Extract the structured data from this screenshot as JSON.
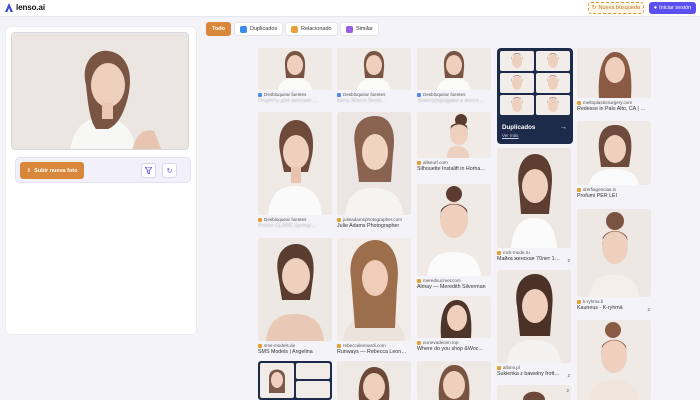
{
  "app": {
    "name": "lenso.ai",
    "new_search": "Nueva búsqueda",
    "login": "Iniciar sesión"
  },
  "left": {
    "upload_label": "Subir nueva foto"
  },
  "tabs": [
    {
      "label": "Todo"
    },
    {
      "label": "Duplicados"
    },
    {
      "label": "Relacionado"
    },
    {
      "label": "Similar"
    }
  ],
  "duplicates": {
    "title": "Duplicados",
    "link": "Ver más"
  },
  "results": {
    "c1r1": {
      "source": "Desbloquear fuentes",
      "caption": "Рецепты для женских ..."
    },
    "c2r1": {
      "source": "Desbloquear fuentes",
      "caption": "Бела Женск Sessi..."
    },
    "c3r1": {
      "source": "Desbloquear fuentes",
      "caption": "Электропродажи и женск..."
    },
    "c5r1": {
      "source": "meltoplasticsurgery.com",
      "caption": "Redesse in Palo Alto, CA | M..."
    },
    "c1r2": {
      "source": "Desbloquear fuentes",
      "caption": "Promo CLARE Spreqp..."
    },
    "c2r2": {
      "source": "julieadamsphotographer.com",
      "caption": "Julie Adams Photographer"
    },
    "c3r2": {
      "source": "allseurf.com",
      "caption": "Silhouette Instalift in Horha..."
    },
    "c5r2": {
      "source": "sterfiagencias.is",
      "caption": "Profumi PER LEI"
    },
    "c3r3": {
      "source": "meredsucreeccom",
      "caption": "Almay — Meredith Silverman"
    },
    "c4r3": {
      "source": "mck-mode.ru",
      "caption": "Майка женская 70лет 12...",
      "count": "2"
    },
    "c5r3": {
      "source": "k-ryhma.fi",
      "caption": "Kauneus - K-ryhmä",
      "count": "2"
    },
    "c1r4": {
      "source": "sms-models.de",
      "caption": "SMS Models | Angelina"
    },
    "c2r4": {
      "source": "rebeccaleonardi.com",
      "caption": "Runways — Rebecca Leonar..."
    },
    "c3r4": {
      "source": "eunevadeonn.top",
      "caption": "Where do you shop &Woc..."
    },
    "c4r4": {
      "source": "allomi.pl",
      "caption": "Sukienka z bawełny frotte...",
      "count": "2"
    },
    "c4r5": {
      "source": "",
      "caption": "",
      "count": "2"
    }
  }
}
